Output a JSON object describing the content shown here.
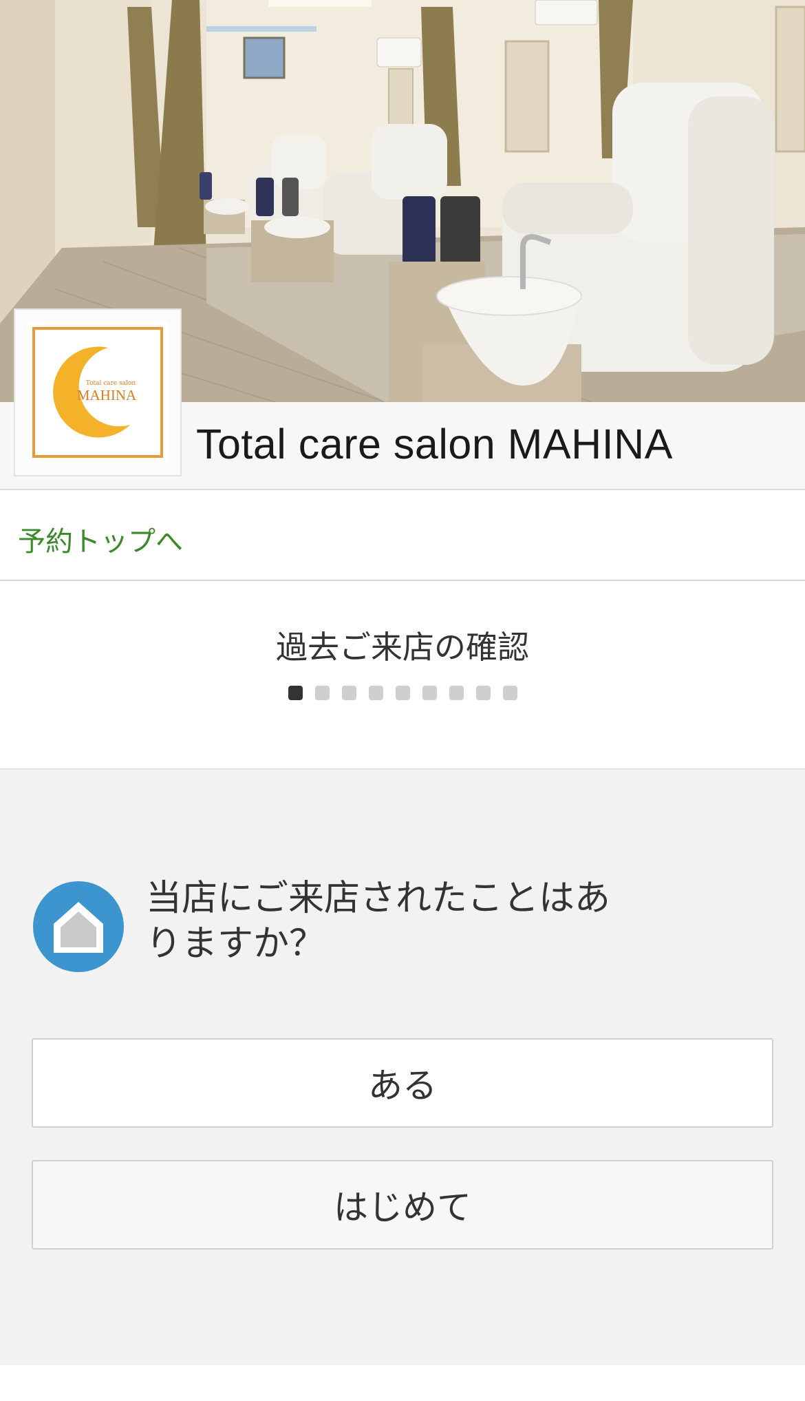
{
  "header": {
    "salon_name": "Total care salon MAHINA",
    "logo": {
      "subtitle": "Total care salon",
      "title": "MAHINA",
      "colors": {
        "crescent": "#f4b12a",
        "border": "#e89a3a",
        "text": "#e07a1f"
      }
    }
  },
  "nav": {
    "top_link_label": "予約トップへ",
    "link_color": "#3a8a2a"
  },
  "step": {
    "title": "過去ご来店の確認",
    "total_steps": 9,
    "current_step": 1
  },
  "question": {
    "icon": "home-icon",
    "icon_color": "#3d95cf",
    "text": "当店にご来店されたことはありますか？"
  },
  "answers": {
    "yes_label": "ある",
    "first_label": "はじめて"
  }
}
